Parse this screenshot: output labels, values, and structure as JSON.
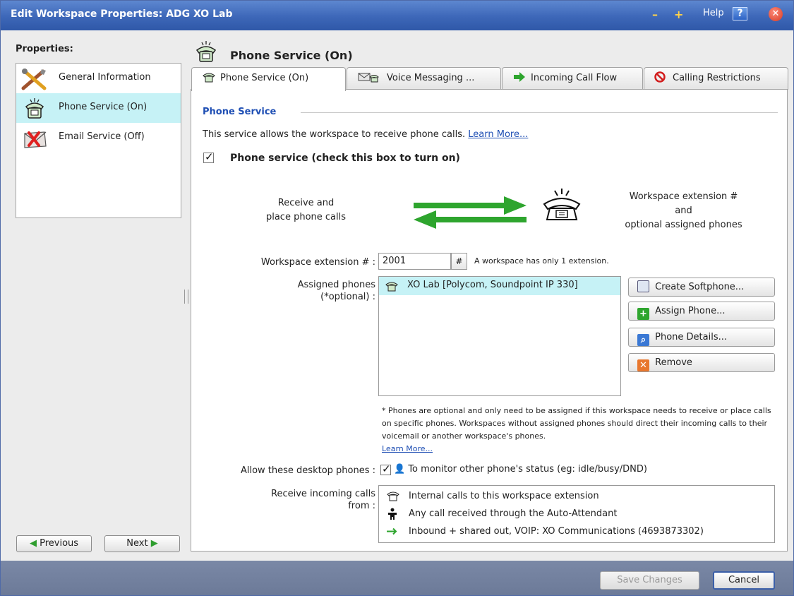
{
  "window": {
    "title": "Edit Workspace Properties: ADG XO Lab",
    "minimize": "–",
    "maximize": "+",
    "help_label": "Help",
    "help_glyph": "?",
    "close_glyph": "✕",
    "accent": "#3d67b8"
  },
  "left": {
    "heading": "Properties:",
    "items": [
      {
        "label": "General Information",
        "icon": "tools-icon"
      },
      {
        "label": "Phone Service (On)",
        "icon": "phone-icon"
      },
      {
        "label": "Email Service (Off)",
        "icon": "email-off-icon"
      }
    ],
    "previous_label": "Previous",
    "next_label": "Next"
  },
  "main": {
    "title": "Phone Service (On)",
    "tabs": [
      {
        "label": "Phone Service (On)",
        "icon": "phone-icon"
      },
      {
        "label": "Voice Messaging ...",
        "icon": "voicemail-icon"
      },
      {
        "label": "Incoming Call Flow",
        "icon": "green-arrow-icon"
      },
      {
        "label": "Calling Restrictions",
        "icon": "no-entry-icon"
      }
    ],
    "section_title": "Phone Service",
    "intro_text": "This service allows the workspace to receive phone calls.",
    "learn_more": "Learn More...",
    "phone_service_checked": true,
    "phone_service_label": "Phone service (check this box to turn on)",
    "diagram_left_line1": "Receive and",
    "diagram_left_line2": "place phone calls",
    "diagram_right_line1": "Workspace extension #",
    "diagram_right_line2": "and",
    "diagram_right_line3": "optional assigned phones",
    "ext_label": "Workspace extension # :",
    "ext_value": "2001",
    "ext_button": "#",
    "ext_note": "A workspace has only 1 extension.",
    "assigned_label_line1": "Assigned phones",
    "assigned_label_line2": "(*optional) :",
    "assigned_phones": [
      "XO Lab [Polycom, Soundpoint IP 330]"
    ],
    "buttons": {
      "create_softphone": "Create Softphone...",
      "assign_phone": "Assign Phone...",
      "phone_details": "Phone Details...",
      "remove": "Remove"
    },
    "footnote": "* Phones are optional and only need to be assigned if this workspace needs to receive or place calls on specific phones. Workspaces without assigned phones should direct their incoming calls to their voicemail or another workspace's phones.",
    "footnote_link": "Learn More...",
    "desktop_label": "Allow these desktop phones :",
    "desktop_checked": true,
    "desktop_text": "To monitor other phone's status (eg: idle/busy/DND)",
    "incoming_label_line1": "Receive incoming calls",
    "incoming_label_line2": "from :",
    "incoming": [
      {
        "text": "Internal calls to this workspace extension",
        "icon": "phone-icon"
      },
      {
        "text": "Any call received through the Auto-Attendant",
        "icon": "attendant-icon"
      },
      {
        "text": "Inbound + shared out, VOIP: XO Communications (4693873302)",
        "icon": "green-arrow-icon"
      }
    ]
  },
  "footer": {
    "save_label": "Save Changes",
    "cancel_label": "Cancel"
  }
}
